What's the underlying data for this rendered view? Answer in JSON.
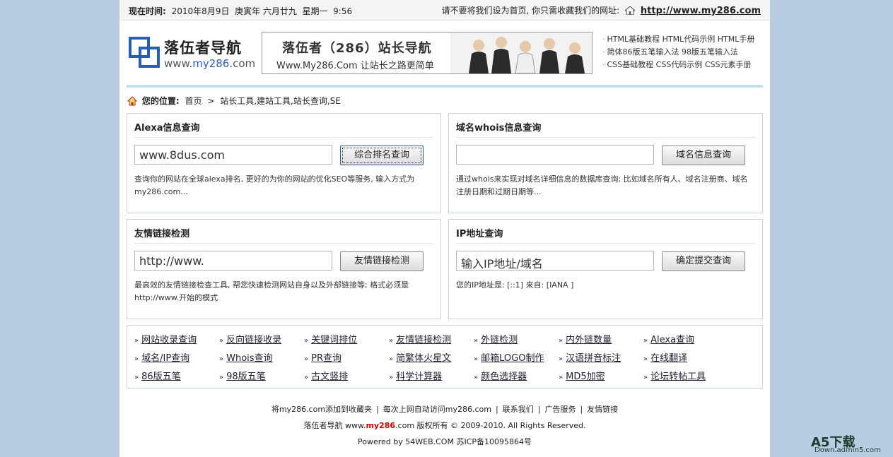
{
  "topbar": {
    "time_label": "现在时间:",
    "time_value": "2010年8月9日  庚寅年 六月廿九  星期一  9:56",
    "notice": "请不要将我们设为首页, 你只需收藏我们的网址:",
    "site_url": "http://www.my286.com"
  },
  "logo": {
    "title": "落伍者导航",
    "url_prefix": "www.",
    "url_brand": "my286",
    "url_suffix": ".com"
  },
  "banner": {
    "title": "落伍者（286）站长导航",
    "subtitle": "Www.My286.Com 让站长之路更简单"
  },
  "quicklinks": [
    [
      "HTML基础教程",
      "HTML代码示例",
      "HTML手册"
    ],
    [
      "简体86版五笔输入法",
      "98版五笔输入法"
    ],
    [
      "CSS基础教程",
      "CSS代码示例",
      "CSS元素手册"
    ]
  ],
  "breadcrumb": {
    "label": "您的位置:",
    "home": "首页",
    "sep": ">",
    "current": "站长工具,建站工具,站长查询,SE"
  },
  "panels": {
    "alexa": {
      "title": "Alexa信息查询",
      "input_value": "www.8dus.com",
      "button": "综合排名查询",
      "desc": "查询你的网站在全球alexa排名, 更好的为你的网站的优化SEO等服务, 输入方式为my286.com..."
    },
    "whois": {
      "title": "域名whois信息查询",
      "input_value": "",
      "button": "域名信息查询",
      "desc": "通过whois来实现对域名详细信息的数据库查询; 比如域名所有人、域名注册商、域名注册日期和过期日期等..."
    },
    "links": {
      "title": "友情链接检测",
      "input_value": "http://www.",
      "button": "友情链接检测",
      "desc": "最高效的友情链接检查工具, 帮您快速检测网站自身以及外部链接等; 格式必须是http://www.开始的模式"
    },
    "ip": {
      "title": "IP地址查询",
      "input_value": "输入IP地址/域名",
      "button": "确定提交查询",
      "desc": "您的IP地址是: [::1]  来自: [IANA ]"
    }
  },
  "tools": [
    [
      "网站收录查询",
      "反向链接收录",
      "关键词排位",
      "友情链接检测",
      "外链检测",
      "内外链数量",
      "Alexa查询"
    ],
    [
      "域名/IP查询",
      "Whois查询",
      "PR查询",
      "简繁体火星文",
      "邮箱LOGO制作",
      "汉语拼音标注",
      "在线翻译"
    ],
    [
      "86版五笔",
      "98版五笔",
      "古文竖排",
      "科学计算器",
      "颜色选择器",
      "MD5加密",
      "论坛转帖工具"
    ]
  ],
  "footer": {
    "links": [
      "将my286.com添加到收藏夹",
      "每次上网自动访问my286.com",
      "联系我们",
      "广告服务",
      "友情链接"
    ],
    "copyright_prefix": "落伍者导航 www.",
    "copyright_brand": "my286",
    "copyright_suffix": ".com 版权所有 © 2009-2010. All Rights Reserved.",
    "powered": "Powered by 54WEB.COM 苏ICP备10095864号"
  },
  "watermark": {
    "main": "A5下载",
    "sub": "Down.admin5.com"
  },
  "colors": {
    "background": "#b7cde2",
    "divider": "#bfe0f0",
    "logo_blue": "#2a5fb0",
    "brand_red": "#cc0000"
  }
}
